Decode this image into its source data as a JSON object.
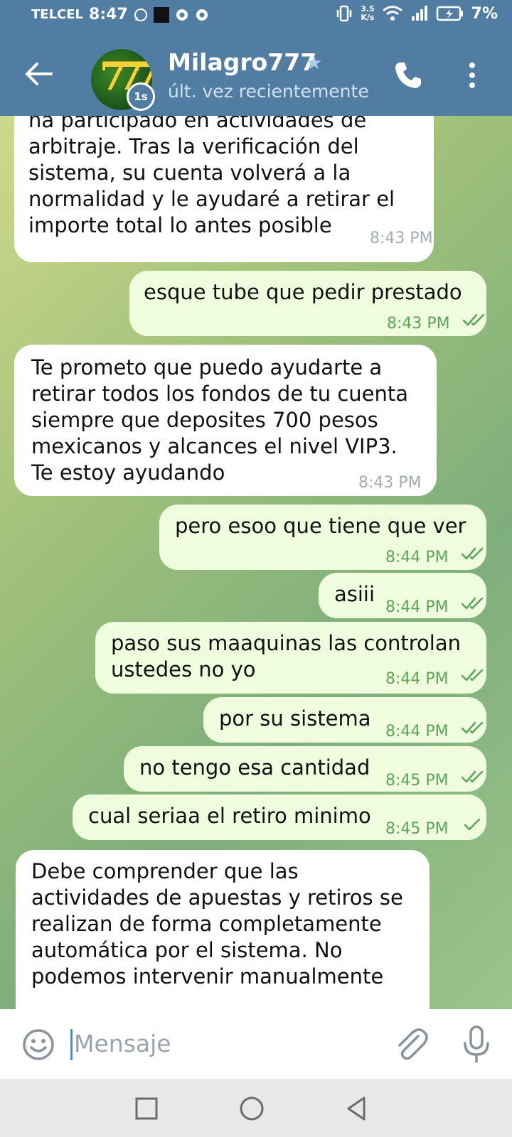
{
  "status_bar": {
    "carrier": "TELCEL",
    "time": "8:47",
    "net_speed_value": "3.5",
    "net_speed_unit": "K/s",
    "battery": "7%"
  },
  "header": {
    "name": "Milagro777",
    "status": "últ. vez recientemente",
    "timer_badge": "1s",
    "avatar_text": "777"
  },
  "messages": [
    {
      "direction": "in",
      "text": "ha participado en actividades de\narbitraje. Tras la verificación del\nsistema, su cuenta volverá a la\nnormalidad y le ayudaré a retirar el\nimporte total lo antes posible",
      "time": "8:43 PM"
    },
    {
      "direction": "out",
      "text": "esque tube que pedir prestado",
      "time": "8:43 PM",
      "status": "read"
    },
    {
      "direction": "in",
      "text": "Te prometo que puedo ayudarte a\nretirar todos los fondos de tu cuenta\nsiempre que deposites 700 pesos\nmexicanos y alcances el nivel VIP3.\nTe estoy ayudando",
      "time": "8:43 PM"
    },
    {
      "direction": "out",
      "text": "pero esoo que tiene que ver",
      "time": "8:44 PM",
      "status": "read"
    },
    {
      "direction": "out",
      "text": "asiii",
      "time": "8:44 PM",
      "status": "read"
    },
    {
      "direction": "out",
      "text": "paso sus maaquinas las controlan\nustedes no yo",
      "time": "8:44 PM",
      "status": "read"
    },
    {
      "direction": "out",
      "text": "por su sistema",
      "time": "8:44 PM",
      "status": "read"
    },
    {
      "direction": "out",
      "text": "no tengo esa cantidad",
      "time": "8:45 PM",
      "status": "read"
    },
    {
      "direction": "out",
      "text": "cual seriaa el retiro minimo",
      "time": "8:45 PM",
      "status": "sent"
    },
    {
      "direction": "in",
      "text": "Debe comprender que las\nactividades de apuestas y retiros se\nrealizan de forma completamente\nautomática por el sistema. No\npodemos intervenir manualmente",
      "time": ""
    }
  ],
  "input": {
    "placeholder": "Mensaje",
    "value": ""
  },
  "colors": {
    "header": "#527da3",
    "incoming_bubble": "#ffffff",
    "outgoing_bubble": "#effdde",
    "outgoing_time": "#5aa55a",
    "incoming_time": "#a4abb2",
    "caret": "#4d8fd6"
  },
  "icons": {
    "back": "arrow-left-icon",
    "verified": "star-icon",
    "call": "phone-icon",
    "menu": "more-vertical-icon",
    "emoji": "smiley-icon",
    "attach": "paperclip-icon",
    "mic": "microphone-icon"
  }
}
